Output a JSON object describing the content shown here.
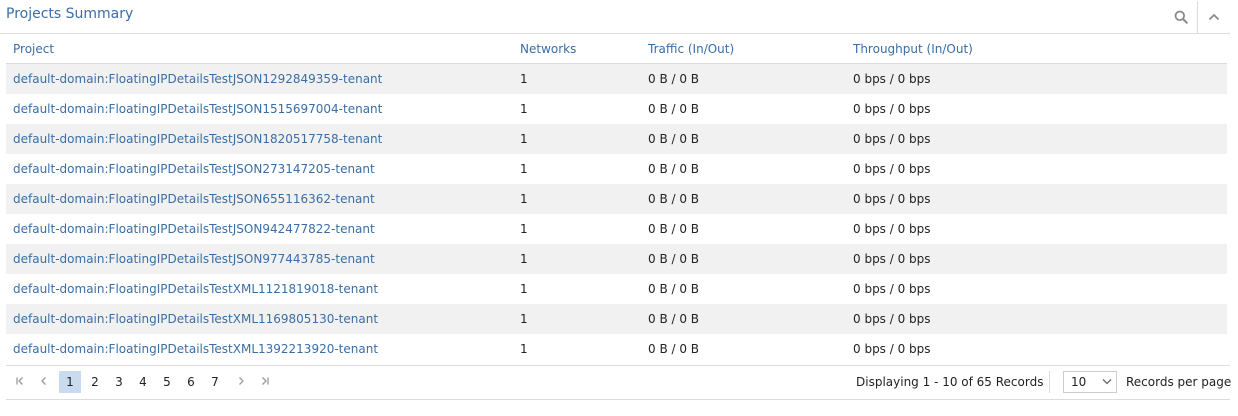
{
  "widget": {
    "title": "Projects Summary",
    "search_icon": "search-icon",
    "collapse_icon": "chevron-up-icon"
  },
  "grid": {
    "columns": [
      "Project",
      "Networks",
      "Traffic (In/Out)",
      "Throughput (In/Out)"
    ],
    "rows": [
      {
        "project": "default-domain:FloatingIPDetailsTestJSON1292849359-tenant",
        "networks": "1",
        "traffic": "0 B / 0 B",
        "throughput": "0 bps / 0 bps"
      },
      {
        "project": "default-domain:FloatingIPDetailsTestJSON1515697004-tenant",
        "networks": "1",
        "traffic": "0 B / 0 B",
        "throughput": "0 bps / 0 bps"
      },
      {
        "project": "default-domain:FloatingIPDetailsTestJSON1820517758-tenant",
        "networks": "1",
        "traffic": "0 B / 0 B",
        "throughput": "0 bps / 0 bps"
      },
      {
        "project": "default-domain:FloatingIPDetailsTestJSON273147205-tenant",
        "networks": "1",
        "traffic": "0 B / 0 B",
        "throughput": "0 bps / 0 bps"
      },
      {
        "project": "default-domain:FloatingIPDetailsTestJSON655116362-tenant",
        "networks": "1",
        "traffic": "0 B / 0 B",
        "throughput": "0 bps / 0 bps"
      },
      {
        "project": "default-domain:FloatingIPDetailsTestJSON942477822-tenant",
        "networks": "1",
        "traffic": "0 B / 0 B",
        "throughput": "0 bps / 0 bps"
      },
      {
        "project": "default-domain:FloatingIPDetailsTestJSON977443785-tenant",
        "networks": "1",
        "traffic": "0 B / 0 B",
        "throughput": "0 bps / 0 bps"
      },
      {
        "project": "default-domain:FloatingIPDetailsTestXML1121819018-tenant",
        "networks": "1",
        "traffic": "0 B / 0 B",
        "throughput": "0 bps / 0 bps"
      },
      {
        "project": "default-domain:FloatingIPDetailsTestXML1169805130-tenant",
        "networks": "1",
        "traffic": "0 B / 0 B",
        "throughput": "0 bps / 0 bps"
      },
      {
        "project": "default-domain:FloatingIPDetailsTestXML1392213920-tenant",
        "networks": "1",
        "traffic": "0 B / 0 B",
        "throughput": "0 bps / 0 bps"
      }
    ]
  },
  "pager": {
    "pages": [
      "1",
      "2",
      "3",
      "4",
      "5",
      "6",
      "7"
    ],
    "current_page": "1",
    "info": "Displaying 1 - 10 of 65 Records",
    "page_size": "10",
    "page_size_label": "Records per page",
    "icons": [
      "first-page-icon",
      "previous-page-icon",
      "next-page-icon",
      "last-page-icon"
    ],
    "active_color": "#c9dcef"
  },
  "colors": {
    "accent": "#3a6ea5",
    "row_alt": "#f1f1f1",
    "border": "#dcdcdc"
  }
}
